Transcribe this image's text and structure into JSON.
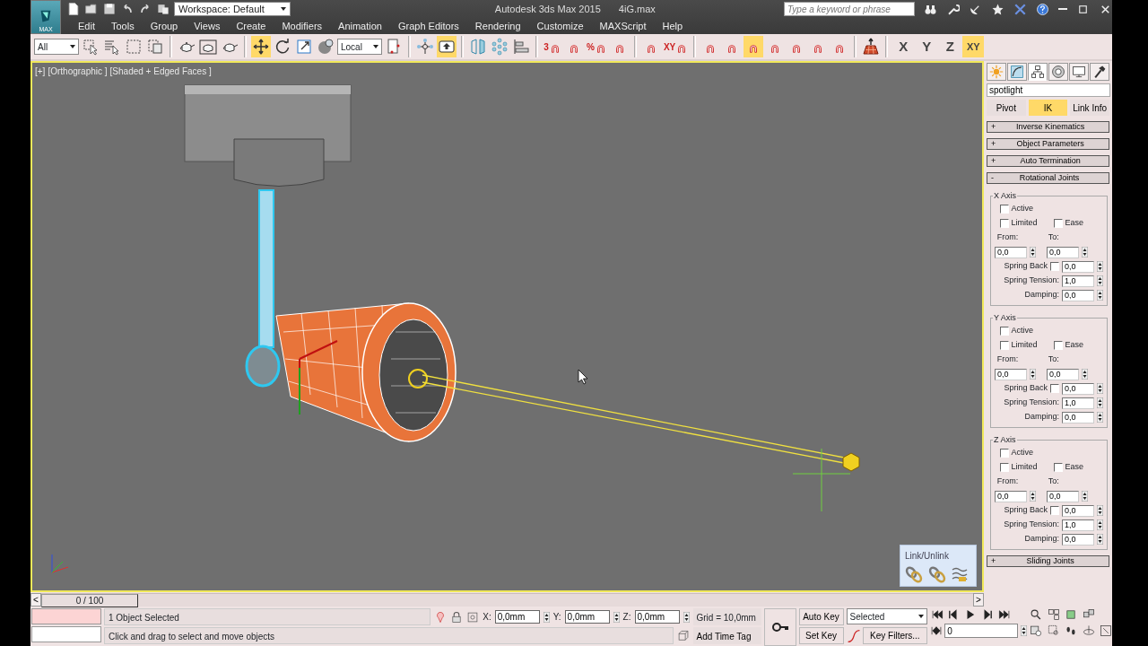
{
  "title_bar": {
    "logo_label": "MAX",
    "workspace": "Workspace: Default",
    "title": "Autodesk 3ds Max 2015",
    "file": "4iG.max",
    "search": {
      "placeholder": "Type a keyword or phrase"
    }
  },
  "menu": [
    "Edit",
    "Tools",
    "Group",
    "Views",
    "Create",
    "Modifiers",
    "Animation",
    "Graph Editors",
    "Rendering",
    "Customize",
    "MAXScript",
    "Help"
  ],
  "toolbar": [
    {
      "kind": "dropdown",
      "value": "All"
    },
    {
      "kind": "icon",
      "selected": false
    },
    {
      "kind": "icon",
      "selected": false
    },
    {
      "kind": "icon",
      "selected": false
    },
    {
      "kind": "icon",
      "selected": false
    },
    {
      "kind": "sep"
    },
    {
      "kind": "icon",
      "selected": false
    },
    {
      "kind": "icon",
      "selected": false
    },
    {
      "kind": "icon",
      "selected": false
    },
    {
      "kind": "sep"
    },
    {
      "kind": "icon",
      "selected": true
    },
    {
      "kind": "icon",
      "selected": false
    },
    {
      "kind": "icon",
      "selected": false
    },
    {
      "kind": "icon",
      "selected": false
    },
    {
      "kind": "dropdown",
      "value": "Local"
    },
    {
      "kind": "icon",
      "selected": false
    },
    {
      "kind": "sep"
    },
    {
      "kind": "icon",
      "selected": false
    },
    {
      "kind": "icon",
      "selected": true
    },
    {
      "kind": "sep"
    },
    {
      "kind": "icon",
      "selected": false
    },
    {
      "kind": "icon",
      "selected": false
    },
    {
      "kind": "icon",
      "selected": false
    },
    {
      "kind": "sep"
    },
    {
      "kind": "snap",
      "glyph": "3",
      "selected": false
    },
    {
      "kind": "snap",
      "selected": false
    },
    {
      "kind": "snap",
      "glyph": "%",
      "selected": false
    },
    {
      "kind": "snap",
      "selected": false
    },
    {
      "kind": "sep"
    },
    {
      "kind": "snap",
      "selected": false
    },
    {
      "kind": "snap",
      "glyph": "XY",
      "selected": false
    },
    {
      "kind": "sep"
    },
    {
      "kind": "snap",
      "selected": false
    },
    {
      "kind": "snap",
      "selected": false
    },
    {
      "kind": "snap",
      "selected": true
    },
    {
      "kind": "snap",
      "selected": false
    },
    {
      "kind": "snap",
      "selected": false
    },
    {
      "kind": "snap",
      "selected": false
    },
    {
      "kind": "snap",
      "selected": false
    },
    {
      "kind": "sep"
    },
    {
      "kind": "icon",
      "selected": false
    },
    {
      "kind": "sep"
    },
    {
      "kind": "axis",
      "label": "X",
      "selected": false
    },
    {
      "kind": "axis",
      "label": "Y",
      "selected": false
    },
    {
      "kind": "axis",
      "label": "Z",
      "selected": false
    },
    {
      "kind": "axis",
      "label": "XY",
      "selected": true
    }
  ],
  "viewport": {
    "labels": [
      "[+]",
      "[Orthographic ]",
      "[Shaded + Edged Faces ]"
    ]
  },
  "link_toolbar": {
    "title": "Link/Unlink"
  },
  "command_panel": {
    "tabs": [
      {
        "selected": false
      },
      {
        "selected": false
      },
      {
        "selected": true
      },
      {
        "selected": false
      },
      {
        "selected": false
      },
      {
        "selected": false
      }
    ],
    "object_name": "spotlight",
    "buttons": [
      {
        "label": "Pivot",
        "selected": false
      },
      {
        "label": "IK",
        "selected": true
      },
      {
        "label": "Link Info",
        "selected": false
      }
    ],
    "rollouts": [
      {
        "sign": "+",
        "label": "Inverse Kinematics"
      },
      {
        "sign": "+",
        "label": "Object Parameters"
      },
      {
        "sign": "+",
        "label": "Auto Termination"
      },
      {
        "sign": "-",
        "label": "Rotational Joints",
        "axes": [
          {
            "title": "X Axis",
            "active": {
              "label": "Active",
              "checked": false
            },
            "limited": {
              "label": "Limited",
              "checked": false
            },
            "ease": {
              "label": "Ease",
              "checked": false
            },
            "from_label": "From:",
            "to_label": "To:",
            "from": "0,0",
            "to": "0,0",
            "spring_back": {
              "label": "Spring Back",
              "checked": false,
              "value": "0,0"
            },
            "spring_tension": {
              "label": "Spring Tension:",
              "value": "1,0"
            },
            "damping": {
              "label": "Damping:",
              "value": "0,0"
            }
          },
          {
            "title": "Y Axis",
            "active": {
              "label": "Active",
              "checked": false
            },
            "limited": {
              "label": "Limited",
              "checked": false
            },
            "ease": {
              "label": "Ease",
              "checked": false
            },
            "from_label": "From:",
            "to_label": "To:",
            "from": "0,0",
            "to": "0,0",
            "spring_back": {
              "label": "Spring Back",
              "checked": false,
              "value": "0,0"
            },
            "spring_tension": {
              "label": "Spring Tension:",
              "value": "1,0"
            },
            "damping": {
              "label": "Damping:",
              "value": "0,0"
            }
          },
          {
            "title": "Z Axis",
            "active": {
              "label": "Active",
              "checked": false
            },
            "limited": {
              "label": "Limited",
              "checked": false
            },
            "ease": {
              "label": "Ease",
              "checked": false
            },
            "from_label": "From:",
            "to_label": "To:",
            "from": "0,0",
            "to": "0,0",
            "spring_back": {
              "label": "Spring Back",
              "checked": false,
              "value": "0,0"
            },
            "spring_tension": {
              "label": "Spring Tension:",
              "value": "1,0"
            },
            "damping": {
              "label": "Damping:",
              "value": "0,0"
            }
          }
        ]
      },
      {
        "sign": "+",
        "label": "Sliding Joints"
      }
    ]
  },
  "timeline": {
    "prev": "<",
    "position": "0 / 100",
    "next": ">",
    "level": 0
  },
  "status": {
    "selection": "1 Object Selected",
    "prompt": "Click and drag to select and move objects",
    "coords": [
      {
        "axis": "X:",
        "value": "0,0mm"
      },
      {
        "axis": "Y:",
        "value": "0,0mm"
      },
      {
        "axis": "Z:",
        "value": "0,0mm"
      }
    ],
    "grid": "Grid = 10,0mm",
    "time_tag": "Add Time Tag",
    "auto_key": "Auto Key",
    "set_key": "Set Key",
    "key_mode": "Selected",
    "key_filters": "Key Filters...",
    "frame": "0"
  }
}
